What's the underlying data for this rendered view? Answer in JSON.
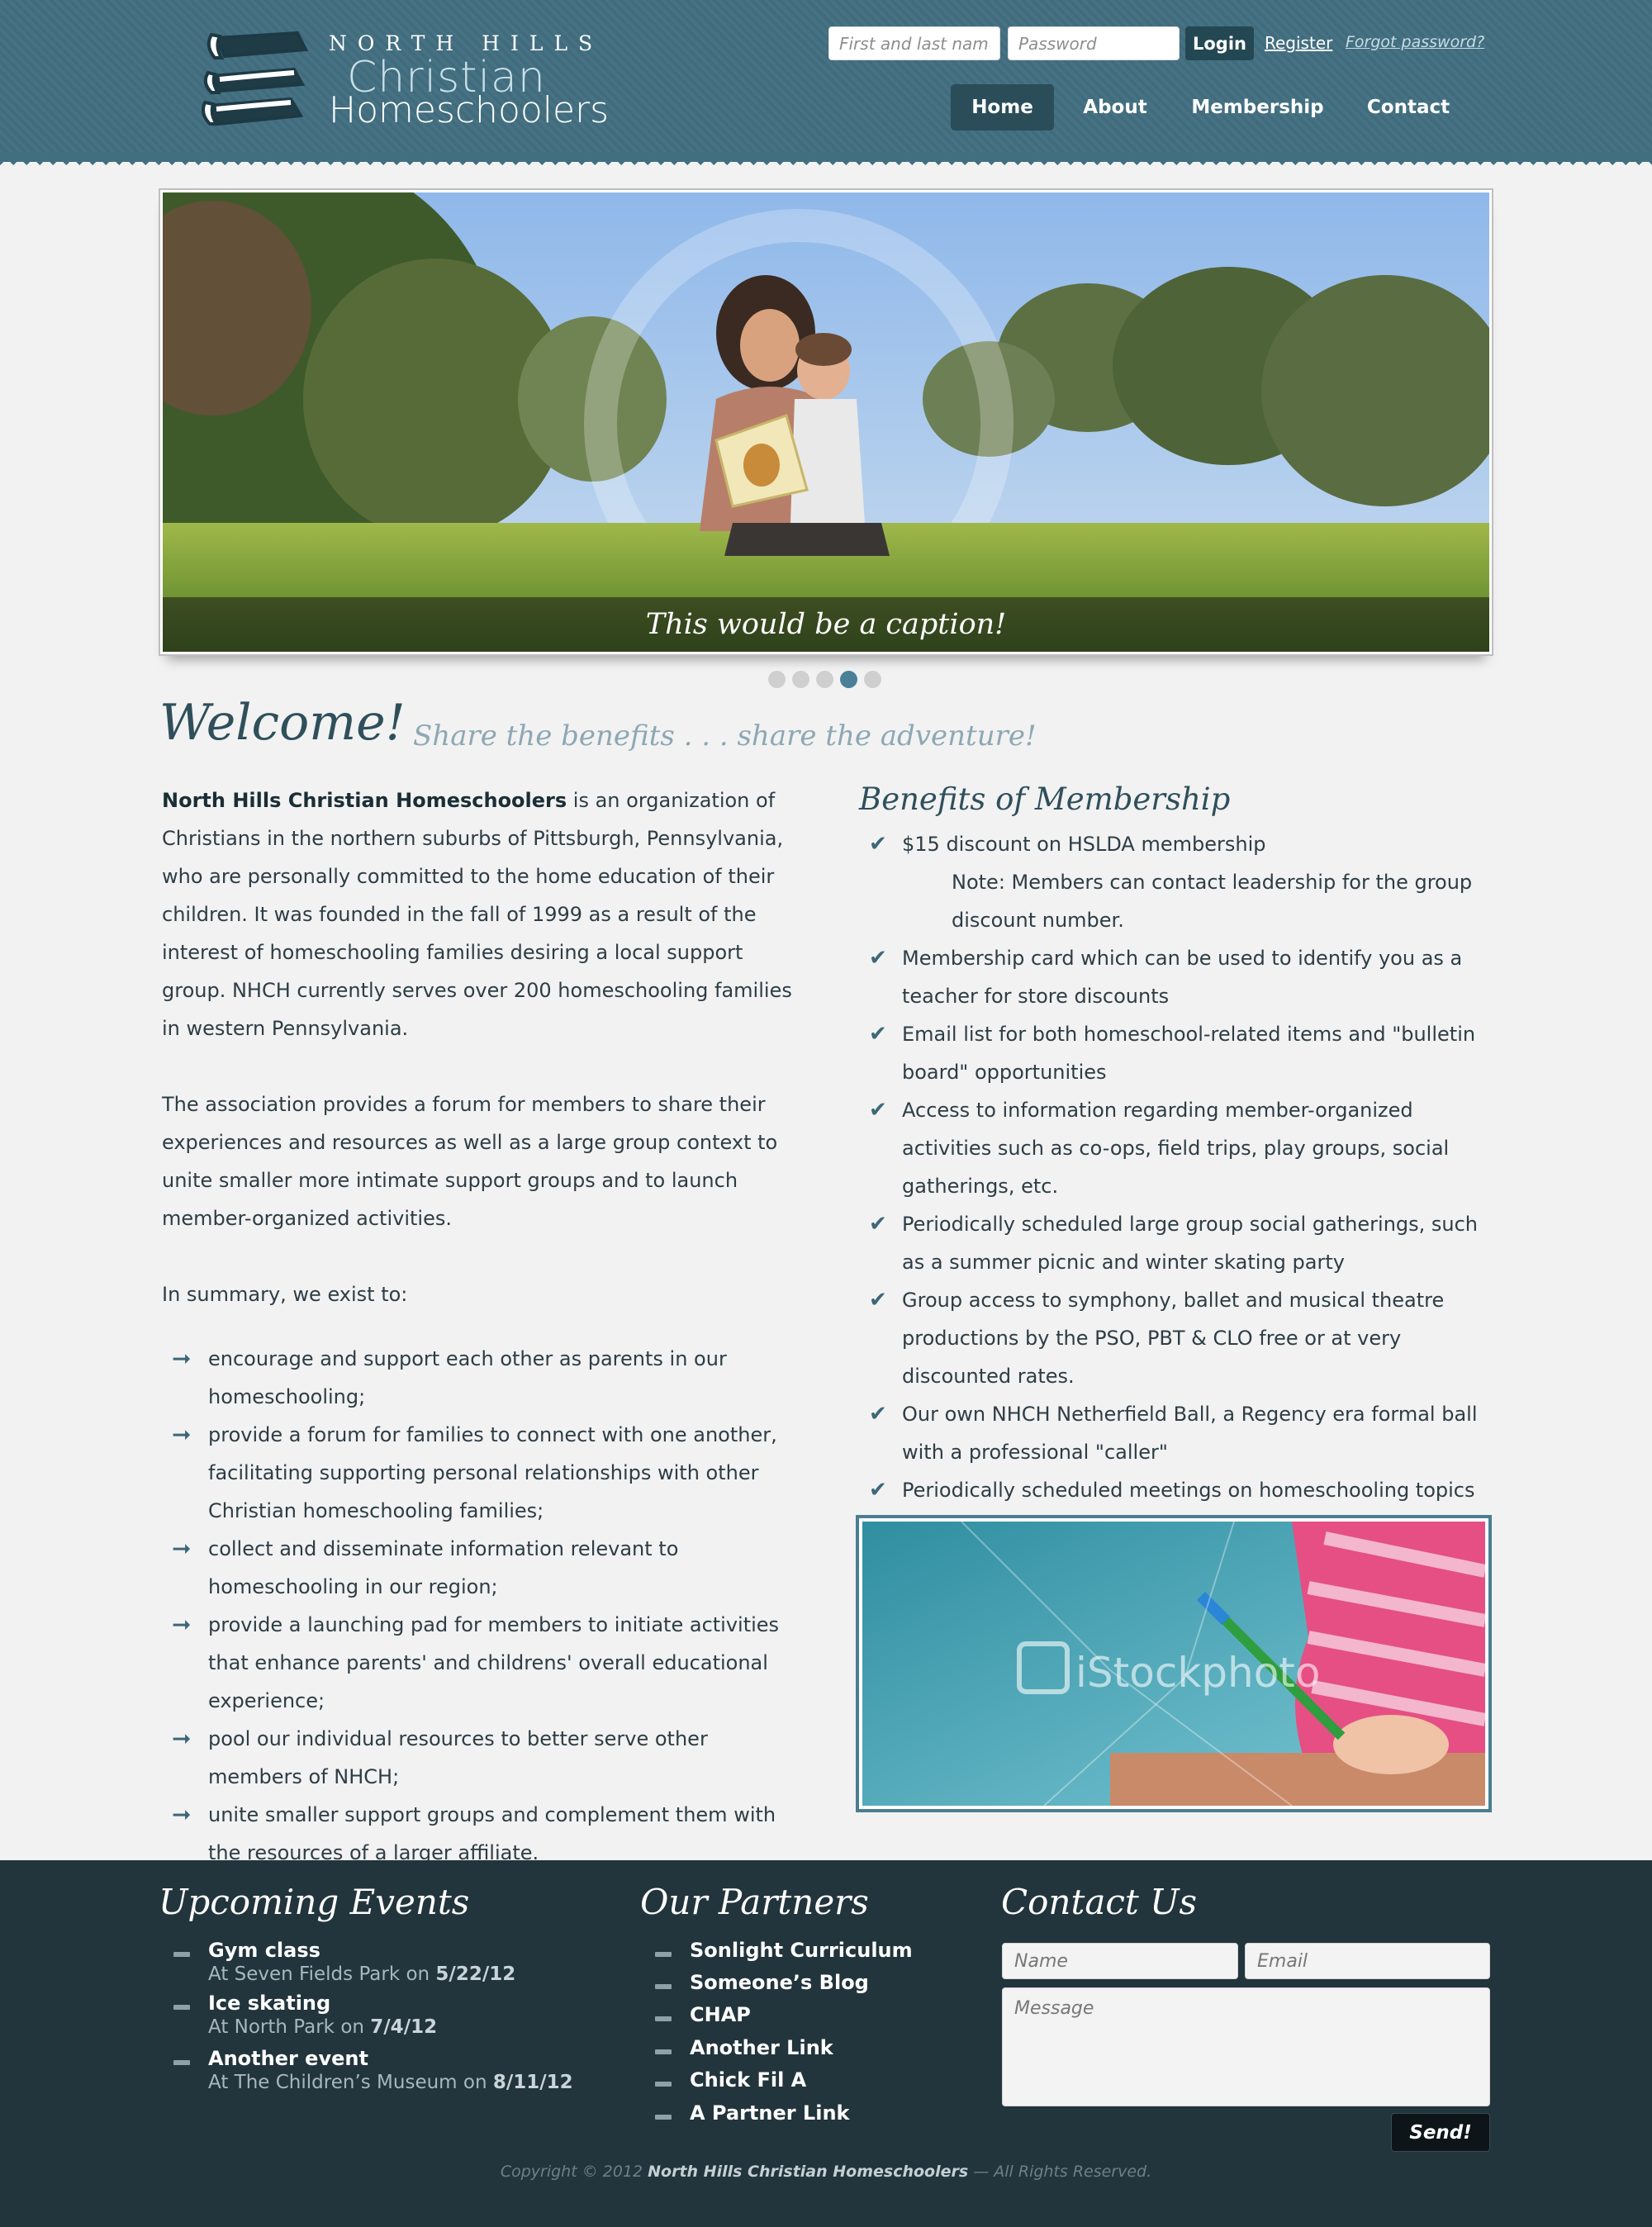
{
  "header": {
    "logo": {
      "line1": "NORTH HILLS",
      "line2": "Christian",
      "line3": "Homeschoolers"
    },
    "login": {
      "name_placeholder": "First and last name",
      "password_placeholder": "Password",
      "login_label": "Login",
      "register_label": "Register",
      "forgot_label": "Forgot password?"
    },
    "nav": [
      {
        "label": "Home",
        "active": true
      },
      {
        "label": "About",
        "active": false
      },
      {
        "label": "Membership",
        "active": false
      },
      {
        "label": "Contact",
        "active": false
      }
    ]
  },
  "slider": {
    "caption": "This would be a caption!",
    "dot_count": 5,
    "active_dot": 4
  },
  "welcome": {
    "title": "Welcome!",
    "tagline": "Share the benefits . . . share the adventure!"
  },
  "intro": {
    "org_name": "North Hills Christian Homeschoolers",
    "p1_rest": " is an organization of Christians in the northern suburbs of Pittsburgh, Pennsylvania, who are personally committed to the home education of their children. It was founded in the fall of 1999 as a result of the interest of homeschooling families desiring a local support group. NHCH currently serves over 200 homeschooling families in western Pennsylvania.",
    "p2": "The association provides a forum for members to share their experiences and resources as well as a large group context to unite smaller more intimate support groups and to launch member-organized activities.",
    "p3": "In summary, we exist to:",
    "goals": [
      "encourage and support each other as parents in our homeschooling;",
      "provide a forum for families to connect with one another, facilitating supporting personal relationships with other Christian homeschooling families;",
      "collect and disseminate information relevant to homeschooling in our region;",
      "provide a launching pad for members to initiate activities that enhance parents' and childrens' overall educational experience;",
      "pool our individual resources to better serve other members of NHCH;",
      "unite smaller support groups and complement them with the resources of a larger affiliate."
    ]
  },
  "benefits": {
    "title": "Benefits of Membership",
    "first": "$15 discount on HSLDA membership",
    "note": "Note: Members can contact leadership for the group discount number.",
    "items": [
      "Membership card which can be used to identify you as a teacher for store discounts",
      "Email list for both homeschool-related items and \"bulletin board\" opportunities",
      "Access to information regarding member-organized activities such as co-ops, field trips, play groups, social gatherings, etc.",
      "Periodically scheduled large group social gatherings, such as a summer picnic and winter skating party",
      "Group access to symphony, ballet and musical theatre productions by the PSO, PBT & CLO free or at very discounted rates.",
      "Our own NHCH Netherfield Ball, a Regency era formal ball with a professional \"caller\"",
      "Periodically scheduled meetings on homeschooling topics of interest"
    ],
    "photo_watermark": "iStockphoto"
  },
  "footer": {
    "events_title": "Upcoming Events",
    "events": [
      {
        "name": "Gym class",
        "prefix": "At Seven Fields Park on ",
        "date": "5/22/12"
      },
      {
        "name": "Ice skating",
        "prefix": "At North Park on ",
        "date": "7/4/12"
      },
      {
        "name": "Another event",
        "prefix": "At The Children’s Museum on ",
        "date": "8/11/12"
      }
    ],
    "partners_title": "Our Partners",
    "partners": [
      "Sonlight Curriculum",
      "Someone’s Blog",
      "CHAP",
      "Another Link",
      "Chick Fil A",
      "A Partner Link"
    ],
    "contact_title": "Contact Us",
    "contact": {
      "name_placeholder": "Name",
      "email_placeholder": "Email",
      "message_placeholder": "Message",
      "send_label": "Send!"
    },
    "copyright_prefix": "Copyright © 2012 ",
    "copyright_org": "North Hills Christian Homeschoolers",
    "copyright_suffix": " — All Rights Reserved."
  },
  "colors": {
    "header_bg": "#426f80",
    "nav_active": "#2a4d59",
    "footer_bg": "#22343c",
    "accent": "#3e6777"
  },
  "icons": {
    "logo": "stacked-books-icon",
    "goal_bullet": "arrow-right-icon",
    "benefit_bullet": "checkmark-icon",
    "footer_bullet": "dash-icon"
  }
}
